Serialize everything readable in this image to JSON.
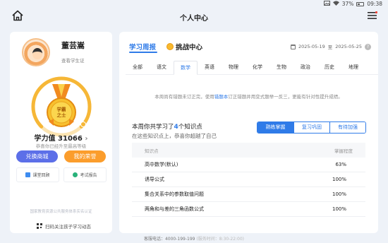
{
  "status_bar": {
    "battery": "37%",
    "time": "09:38"
  },
  "header": {
    "title": "个人中心"
  },
  "profile": {
    "name": "董芸嵩",
    "student_id_link": "查看学生证",
    "score_label": "学力值",
    "score_value": "31066",
    "score_sub": "恭喜你已经升至最高等级",
    "mall_label": "兑换商城",
    "honor_label": "我的荣誉",
    "review_label": "课堂回顾",
    "exam_label": "考试报告",
    "foot_note": "国家教育资源公共服务体系实名认证",
    "qr_text": "扫码关注孩子学习动态"
  },
  "report": {
    "tab_weekly": "学习周报",
    "tab_challenge": "挑战中心",
    "date_start": "2025-05-19",
    "date_sep": "至",
    "date_end": "2025-05-25",
    "subjects": [
      "全部",
      "语文",
      "数学",
      "英语",
      "物理",
      "化学",
      "生物",
      "政治",
      "历史",
      "地理"
    ],
    "active_subject": "数学",
    "notice_pre": "本周尚有错题未订正完，使用",
    "notice_link": "错题本",
    "notice_post": "订正错题并用变式题举一反三，更能有针对性提升成绩。",
    "summary_pre": "本周你共学习了",
    "summary_count": "4",
    "summary_post": "个知识点",
    "summary_sub": "在这些知识点上，恭喜你超越了自己",
    "segments": [
      "熟练掌握",
      "复习巩固",
      "有待加强"
    ],
    "active_segment": "熟练掌握",
    "table_headers": [
      "知识点",
      "掌握程度"
    ],
    "rows": [
      {
        "topic": "高中数学(默认)",
        "level": "63%"
      },
      {
        "topic": "诱导公式",
        "level": "100%"
      },
      {
        "topic": "集合关系中的参数取值问题",
        "level": "100%"
      },
      {
        "topic": "两角和与差的三角函数公式",
        "level": "100%"
      }
    ]
  },
  "footer": {
    "contact": "客服电话：4000-199-199",
    "hours": "(服务时间：8:30-22:00)"
  },
  "colors": {
    "accent": "#2f7be8",
    "mall": "#5c6fe8",
    "honor": "#fb9d2c",
    "medal": "#f6b737"
  }
}
